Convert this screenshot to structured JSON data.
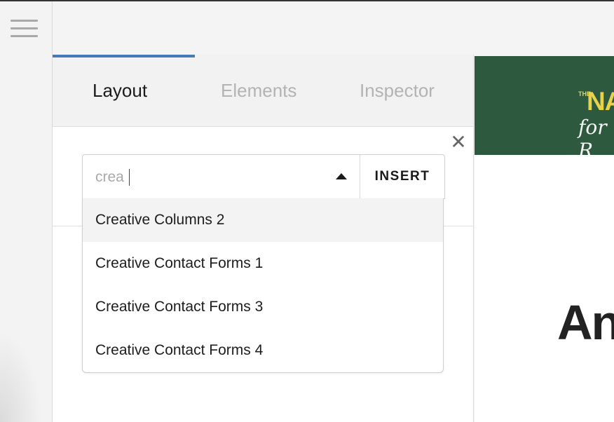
{
  "tabs": [
    {
      "label": "Layout",
      "active": true
    },
    {
      "label": "Elements",
      "active": false
    },
    {
      "label": "Inspector",
      "active": false
    }
  ],
  "search": {
    "value": "crea",
    "insert_label": "INSERT"
  },
  "dropdown": {
    "options": [
      "Creative Columns 2",
      "Creative Contact Forms 1",
      "Creative Contact Forms 3",
      "Creative Contact Forms 4"
    ],
    "highlighted_index": 0
  },
  "preview": {
    "logo_small": "THE",
    "logo_main": "NA",
    "logo_sub": "for R",
    "heading": "An"
  },
  "icons": {
    "menu": "hamburger-icon",
    "close": "close-icon",
    "toggle": "chevron-up-icon"
  },
  "colors": {
    "tab_indicator": "#4a7ab5",
    "banner": "#2d5a3e",
    "logo_accent": "#e8d24b"
  }
}
